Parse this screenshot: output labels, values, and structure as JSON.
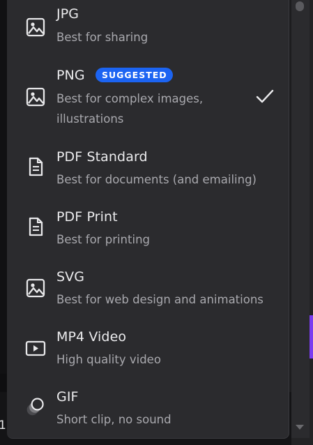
{
  "options": [
    {
      "id": "jpg",
      "icon": "image-icon",
      "title": "JPG",
      "description": "Best for sharing"
    },
    {
      "id": "png",
      "icon": "image-icon",
      "title": "PNG",
      "badge": "SUGGESTED",
      "description": "Best for complex images, illustrations",
      "selected": true
    },
    {
      "id": "pdf-standard",
      "icon": "document-icon",
      "title": "PDF Standard",
      "description": "Best for documents (and emailing)"
    },
    {
      "id": "pdf-print",
      "icon": "document-icon",
      "title": "PDF Print",
      "description": "Best for printing"
    },
    {
      "id": "svg",
      "icon": "image-icon",
      "title": "SVG",
      "description": "Best for web design and animations"
    },
    {
      "id": "mp4",
      "icon": "video-icon",
      "title": "MP4 Video",
      "description": "High quality video"
    },
    {
      "id": "gif",
      "icon": "gif-icon",
      "title": "GIF",
      "description": "Short clip, no sound"
    }
  ],
  "colors": {
    "menu_bg": "#2b2b2e",
    "badge_bg": "#1c64f2",
    "text_primary": "#ececee",
    "text_secondary": "#a9a9ae"
  },
  "backdrop": {
    "edge_char": "1"
  }
}
